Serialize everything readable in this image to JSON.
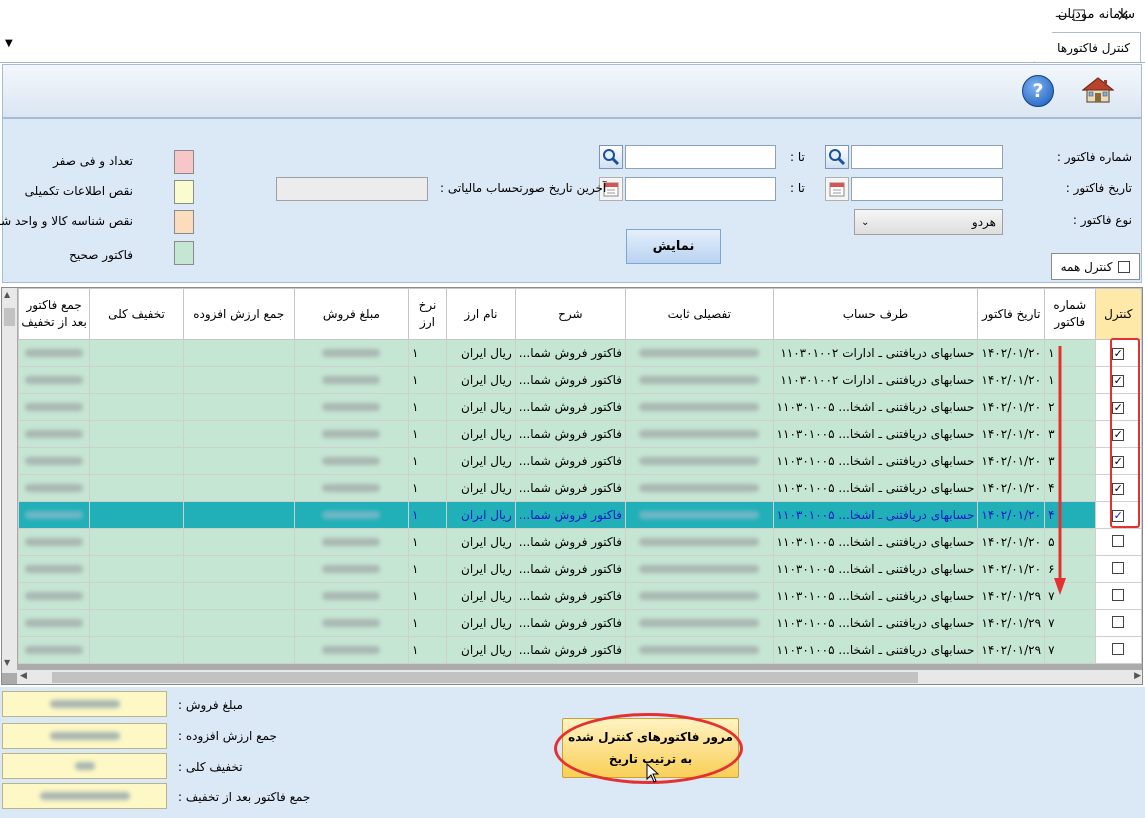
{
  "window": {
    "title": "سامانه مودیان"
  },
  "tabs": [
    {
      "label": "کنترل فاکتورها"
    }
  ],
  "filters": {
    "invoice_number_label": "شماره فاکتور :",
    "invoice_date_label": "تاریخ فاکتور :",
    "invoice_type_label": "نوع فاکتور :",
    "to_label": "تا :",
    "last_tax_date_label": "آخرین تاریخ صورتحساب مالیاتی :",
    "invoice_type_value": "هردو",
    "show_button": "نمایش",
    "control_all": "کنترل همه"
  },
  "legend": [
    {
      "label": "تعداد و فی صفر",
      "color": "#f7c6c9"
    },
    {
      "label": "نقص اطلاعات تکمیلی",
      "color": "#fbfbd0"
    },
    {
      "label": "نقص شناسه کالا و واحد شمارش",
      "color": "#fbdcbc"
    },
    {
      "label": "فاکتور صحیح",
      "color": "#c6e6d4"
    }
  ],
  "grid": {
    "headers": {
      "control": "کنترل",
      "invoice_no": "شماره فاکتور",
      "invoice_date": "تاریخ فاکتور",
      "account": "طرف حساب",
      "detail": "تفصیلی ثابت",
      "description": "شرح",
      "currency": "نام ارز",
      "rate": "نرخ ارز",
      "sales_amount": "مبلغ فروش",
      "vat_total": "جمع ارزش افزوده",
      "discount": "تخفیف کلی",
      "total_after": "جمع فاکتور بعد از تخفیف"
    },
    "rows": [
      {
        "checked": "✓",
        "no": "۱",
        "date": "۱۴۰۲/۰۱/۲۰",
        "account_code": "۱۱۰۳۰۱۰۰۲",
        "account_name": "حسابهای دریافتنی ـ ادارات",
        "desc": "فاکتور فروش شما...",
        "currency": "ریال ایران",
        "rate": "۱"
      },
      {
        "checked": "✓",
        "no": "۱",
        "date": "۱۴۰۲/۰۱/۲۰",
        "account_code": "۱۱۰۳۰۱۰۰۲",
        "account_name": "حسابهای دریافتنی ـ ادارات",
        "desc": "فاکتور فروش شما...",
        "currency": "ریال ایران",
        "rate": "۱"
      },
      {
        "checked": "✓",
        "no": "۲",
        "date": "۱۴۰۲/۰۱/۲۰",
        "account_code": "۱۱۰۳۰۱۰۰۵",
        "account_name": "حسابهای دریافتنی ـ اشخا...",
        "desc": "فاکتور فروش شما...",
        "currency": "ریال ایران",
        "rate": "۱"
      },
      {
        "checked": "✓",
        "no": "۳",
        "date": "۱۴۰۲/۰۱/۲۰",
        "account_code": "۱۱۰۳۰۱۰۰۵",
        "account_name": "حسابهای دریافتنی ـ اشخا...",
        "desc": "فاکتور فروش شما...",
        "currency": "ریال ایران",
        "rate": "۱"
      },
      {
        "checked": "✓",
        "no": "۳",
        "date": "۱۴۰۲/۰۱/۲۰",
        "account_code": "۱۱۰۳۰۱۰۰۵",
        "account_name": "حسابهای دریافتنی ـ اشخا...",
        "desc": "فاکتور فروش شما...",
        "currency": "ریال ایران",
        "rate": "۱"
      },
      {
        "checked": "✓",
        "no": "۴",
        "date": "۱۴۰۲/۰۱/۲۰",
        "account_code": "۱۱۰۳۰۱۰۰۵",
        "account_name": "حسابهای دریافتنی ـ اشخا...",
        "desc": "فاکتور فروش شما...",
        "currency": "ریال ایران",
        "rate": "۱"
      },
      {
        "checked": "✓",
        "no": "۴",
        "date": "۱۴۰۲/۰۱/۲۰",
        "account_code": "۱۱۰۳۰۱۰۰۵",
        "account_name": "حسابهای دریافتنی ـ اشخا...",
        "desc": "فاکتور فروش شما...",
        "currency": "ریال ایران",
        "rate": "۱"
      },
      {
        "checked": "",
        "no": "۵",
        "date": "۱۴۰۲/۰۱/۲۰",
        "account_code": "۱۱۰۳۰۱۰۰۵",
        "account_name": "حسابهای دریافتنی ـ اشخا...",
        "desc": "فاکتور فروش شما...",
        "currency": "ریال ایران",
        "rate": "۱"
      },
      {
        "checked": "",
        "no": "۶",
        "date": "۱۴۰۲/۰۱/۲۰",
        "account_code": "۱۱۰۳۰۱۰۰۵",
        "account_name": "حسابهای دریافتنی ـ اشخا...",
        "desc": "فاکتور فروش شما...",
        "currency": "ریال ایران",
        "rate": "۱"
      },
      {
        "checked": "",
        "no": "۷",
        "date": "۱۴۰۲/۰۱/۲۹",
        "account_code": "۱۱۰۳۰۱۰۰۵",
        "account_name": "حسابهای دریافتنی ـ اشخا...",
        "desc": "فاکتور فروش شما...",
        "currency": "ریال ایران",
        "rate": "۱"
      },
      {
        "checked": "",
        "no": "۷",
        "date": "۱۴۰۲/۰۱/۲۹",
        "account_code": "۱۱۰۳۰۱۰۰۵",
        "account_name": "حسابهای دریافتنی ـ اشخا...",
        "desc": "فاکتور فروش شما...",
        "currency": "ریال ایران",
        "rate": "۱"
      },
      {
        "checked": "",
        "no": "۷",
        "date": "۱۴۰۲/۰۱/۲۹",
        "account_code": "۱۱۰۳۰۱۰۰۵",
        "account_name": "حسابهای دریافتنی ـ اشخا...",
        "desc": "فاکتور فروش شما...",
        "currency": "ریال ایران",
        "rate": "۱"
      }
    ],
    "selected_row": 6
  },
  "summary": {
    "sales_label": "مبلغ فروش :",
    "vat_label": "جمع ارزش افزوده :",
    "discount_label": "تخفیف کلی :",
    "total_label": "جمع فاکتور بعد از تخفیف :"
  },
  "review_button": "مرور فاکتورهای کنترل شده به ترتیب تاریخ"
}
